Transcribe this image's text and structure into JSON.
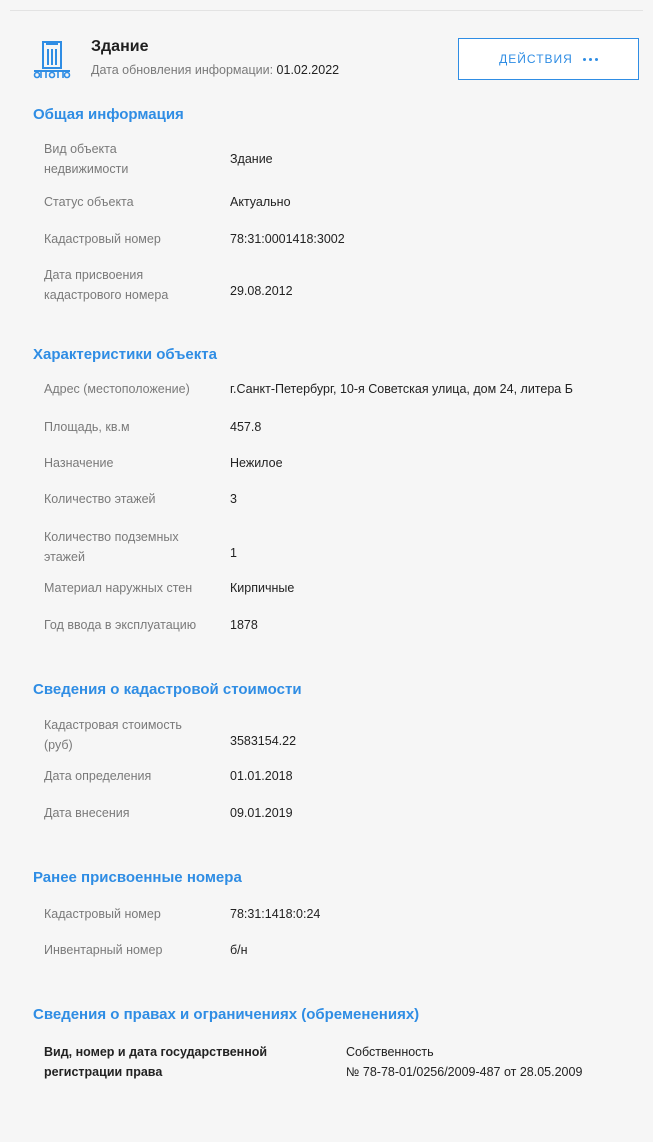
{
  "header": {
    "title": "Здание",
    "update_label": "Дата обновления информации:",
    "update_date": "01.02.2022",
    "actions_label": "ДЕЙСТВИЯ",
    "icon": "building-icon",
    "accent_color": "#2f8de4"
  },
  "general": {
    "title": "Общая информация",
    "rows": [
      {
        "label": "Вид объекта недвижимости",
        "value": "Здание"
      },
      {
        "label": "Статус объекта",
        "value": "Актуально"
      },
      {
        "label": "Кадастровый номер",
        "value": "78:31:0001418:3002"
      },
      {
        "label": "Дата присвоения кадастрового номера",
        "value": "29.08.2012"
      }
    ]
  },
  "characteristics": {
    "title": "Характеристики объекта",
    "rows": [
      {
        "label": "Адрес (местоположение)",
        "value": "г.Санкт-Петербург, 10-я Советская улица, дом 24, литера Б"
      },
      {
        "label": "Площадь, кв.м",
        "value": "457.8"
      },
      {
        "label": "Назначение",
        "value": "Нежилое"
      },
      {
        "label": "Количество этажей",
        "value": "3"
      },
      {
        "label": "Количество подземных этажей",
        "value": "1"
      },
      {
        "label": "Материал наружных стен",
        "value": "Кирпичные"
      },
      {
        "label": "Год ввода в эксплуатацию",
        "value": "1878"
      }
    ]
  },
  "cadastral_value": {
    "title": "Сведения о кадастровой стоимости",
    "rows": [
      {
        "label": "Кадастровая стоимость (руб)",
        "value": "3583154.22"
      },
      {
        "label": "Дата определения",
        "value": "01.01.2018"
      },
      {
        "label": "Дата внесения",
        "value": "09.01.2019"
      }
    ]
  },
  "previous_numbers": {
    "title": "Ранее присвоенные номера",
    "rows": [
      {
        "label": "Кадастровый номер",
        "value": "78:31:1418:0:24"
      },
      {
        "label": "Инвентарный номер",
        "value": "б/н"
      }
    ]
  },
  "rights": {
    "title": "Сведения о правах и ограничениях (обременениях)",
    "label": "Вид, номер и дата государственной регистрации права",
    "value_line1": "Собственность",
    "value_line2": "№ 78-78-01/0256/2009-487 от 28.05.2009"
  }
}
